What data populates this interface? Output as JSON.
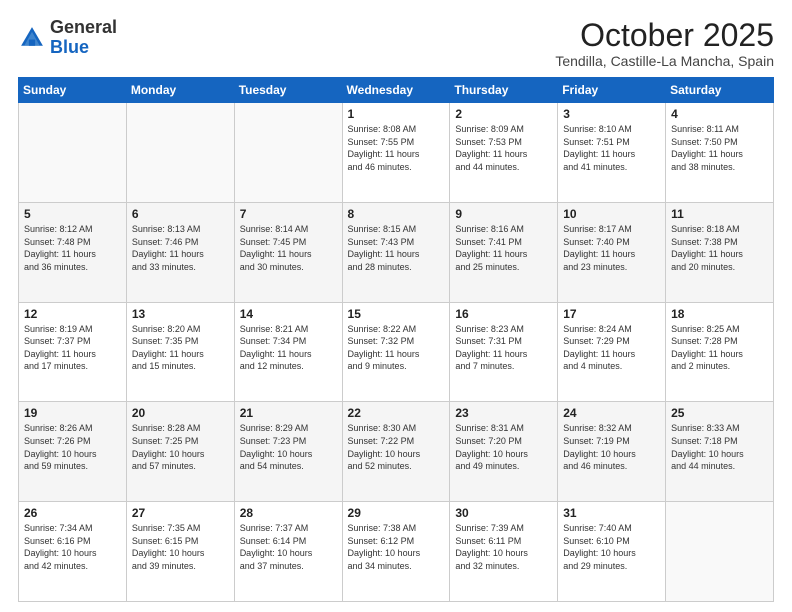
{
  "header": {
    "logo": {
      "general": "General",
      "blue": "Blue"
    },
    "month": "October 2025",
    "location": "Tendilla, Castille-La Mancha, Spain"
  },
  "days_of_week": [
    "Sunday",
    "Monday",
    "Tuesday",
    "Wednesday",
    "Thursday",
    "Friday",
    "Saturday"
  ],
  "weeks": [
    [
      {
        "day": "",
        "info": ""
      },
      {
        "day": "",
        "info": ""
      },
      {
        "day": "",
        "info": ""
      },
      {
        "day": "1",
        "info": "Sunrise: 8:08 AM\nSunset: 7:55 PM\nDaylight: 11 hours\nand 46 minutes."
      },
      {
        "day": "2",
        "info": "Sunrise: 8:09 AM\nSunset: 7:53 PM\nDaylight: 11 hours\nand 44 minutes."
      },
      {
        "day": "3",
        "info": "Sunrise: 8:10 AM\nSunset: 7:51 PM\nDaylight: 11 hours\nand 41 minutes."
      },
      {
        "day": "4",
        "info": "Sunrise: 8:11 AM\nSunset: 7:50 PM\nDaylight: 11 hours\nand 38 minutes."
      }
    ],
    [
      {
        "day": "5",
        "info": "Sunrise: 8:12 AM\nSunset: 7:48 PM\nDaylight: 11 hours\nand 36 minutes."
      },
      {
        "day": "6",
        "info": "Sunrise: 8:13 AM\nSunset: 7:46 PM\nDaylight: 11 hours\nand 33 minutes."
      },
      {
        "day": "7",
        "info": "Sunrise: 8:14 AM\nSunset: 7:45 PM\nDaylight: 11 hours\nand 30 minutes."
      },
      {
        "day": "8",
        "info": "Sunrise: 8:15 AM\nSunset: 7:43 PM\nDaylight: 11 hours\nand 28 minutes."
      },
      {
        "day": "9",
        "info": "Sunrise: 8:16 AM\nSunset: 7:41 PM\nDaylight: 11 hours\nand 25 minutes."
      },
      {
        "day": "10",
        "info": "Sunrise: 8:17 AM\nSunset: 7:40 PM\nDaylight: 11 hours\nand 23 minutes."
      },
      {
        "day": "11",
        "info": "Sunrise: 8:18 AM\nSunset: 7:38 PM\nDaylight: 11 hours\nand 20 minutes."
      }
    ],
    [
      {
        "day": "12",
        "info": "Sunrise: 8:19 AM\nSunset: 7:37 PM\nDaylight: 11 hours\nand 17 minutes."
      },
      {
        "day": "13",
        "info": "Sunrise: 8:20 AM\nSunset: 7:35 PM\nDaylight: 11 hours\nand 15 minutes."
      },
      {
        "day": "14",
        "info": "Sunrise: 8:21 AM\nSunset: 7:34 PM\nDaylight: 11 hours\nand 12 minutes."
      },
      {
        "day": "15",
        "info": "Sunrise: 8:22 AM\nSunset: 7:32 PM\nDaylight: 11 hours\nand 9 minutes."
      },
      {
        "day": "16",
        "info": "Sunrise: 8:23 AM\nSunset: 7:31 PM\nDaylight: 11 hours\nand 7 minutes."
      },
      {
        "day": "17",
        "info": "Sunrise: 8:24 AM\nSunset: 7:29 PM\nDaylight: 11 hours\nand 4 minutes."
      },
      {
        "day": "18",
        "info": "Sunrise: 8:25 AM\nSunset: 7:28 PM\nDaylight: 11 hours\nand 2 minutes."
      }
    ],
    [
      {
        "day": "19",
        "info": "Sunrise: 8:26 AM\nSunset: 7:26 PM\nDaylight: 10 hours\nand 59 minutes."
      },
      {
        "day": "20",
        "info": "Sunrise: 8:28 AM\nSunset: 7:25 PM\nDaylight: 10 hours\nand 57 minutes."
      },
      {
        "day": "21",
        "info": "Sunrise: 8:29 AM\nSunset: 7:23 PM\nDaylight: 10 hours\nand 54 minutes."
      },
      {
        "day": "22",
        "info": "Sunrise: 8:30 AM\nSunset: 7:22 PM\nDaylight: 10 hours\nand 52 minutes."
      },
      {
        "day": "23",
        "info": "Sunrise: 8:31 AM\nSunset: 7:20 PM\nDaylight: 10 hours\nand 49 minutes."
      },
      {
        "day": "24",
        "info": "Sunrise: 8:32 AM\nSunset: 7:19 PM\nDaylight: 10 hours\nand 46 minutes."
      },
      {
        "day": "25",
        "info": "Sunrise: 8:33 AM\nSunset: 7:18 PM\nDaylight: 10 hours\nand 44 minutes."
      }
    ],
    [
      {
        "day": "26",
        "info": "Sunrise: 7:34 AM\nSunset: 6:16 PM\nDaylight: 10 hours\nand 42 minutes."
      },
      {
        "day": "27",
        "info": "Sunrise: 7:35 AM\nSunset: 6:15 PM\nDaylight: 10 hours\nand 39 minutes."
      },
      {
        "day": "28",
        "info": "Sunrise: 7:37 AM\nSunset: 6:14 PM\nDaylight: 10 hours\nand 37 minutes."
      },
      {
        "day": "29",
        "info": "Sunrise: 7:38 AM\nSunset: 6:12 PM\nDaylight: 10 hours\nand 34 minutes."
      },
      {
        "day": "30",
        "info": "Sunrise: 7:39 AM\nSunset: 6:11 PM\nDaylight: 10 hours\nand 32 minutes."
      },
      {
        "day": "31",
        "info": "Sunrise: 7:40 AM\nSunset: 6:10 PM\nDaylight: 10 hours\nand 29 minutes."
      },
      {
        "day": "",
        "info": ""
      }
    ]
  ]
}
